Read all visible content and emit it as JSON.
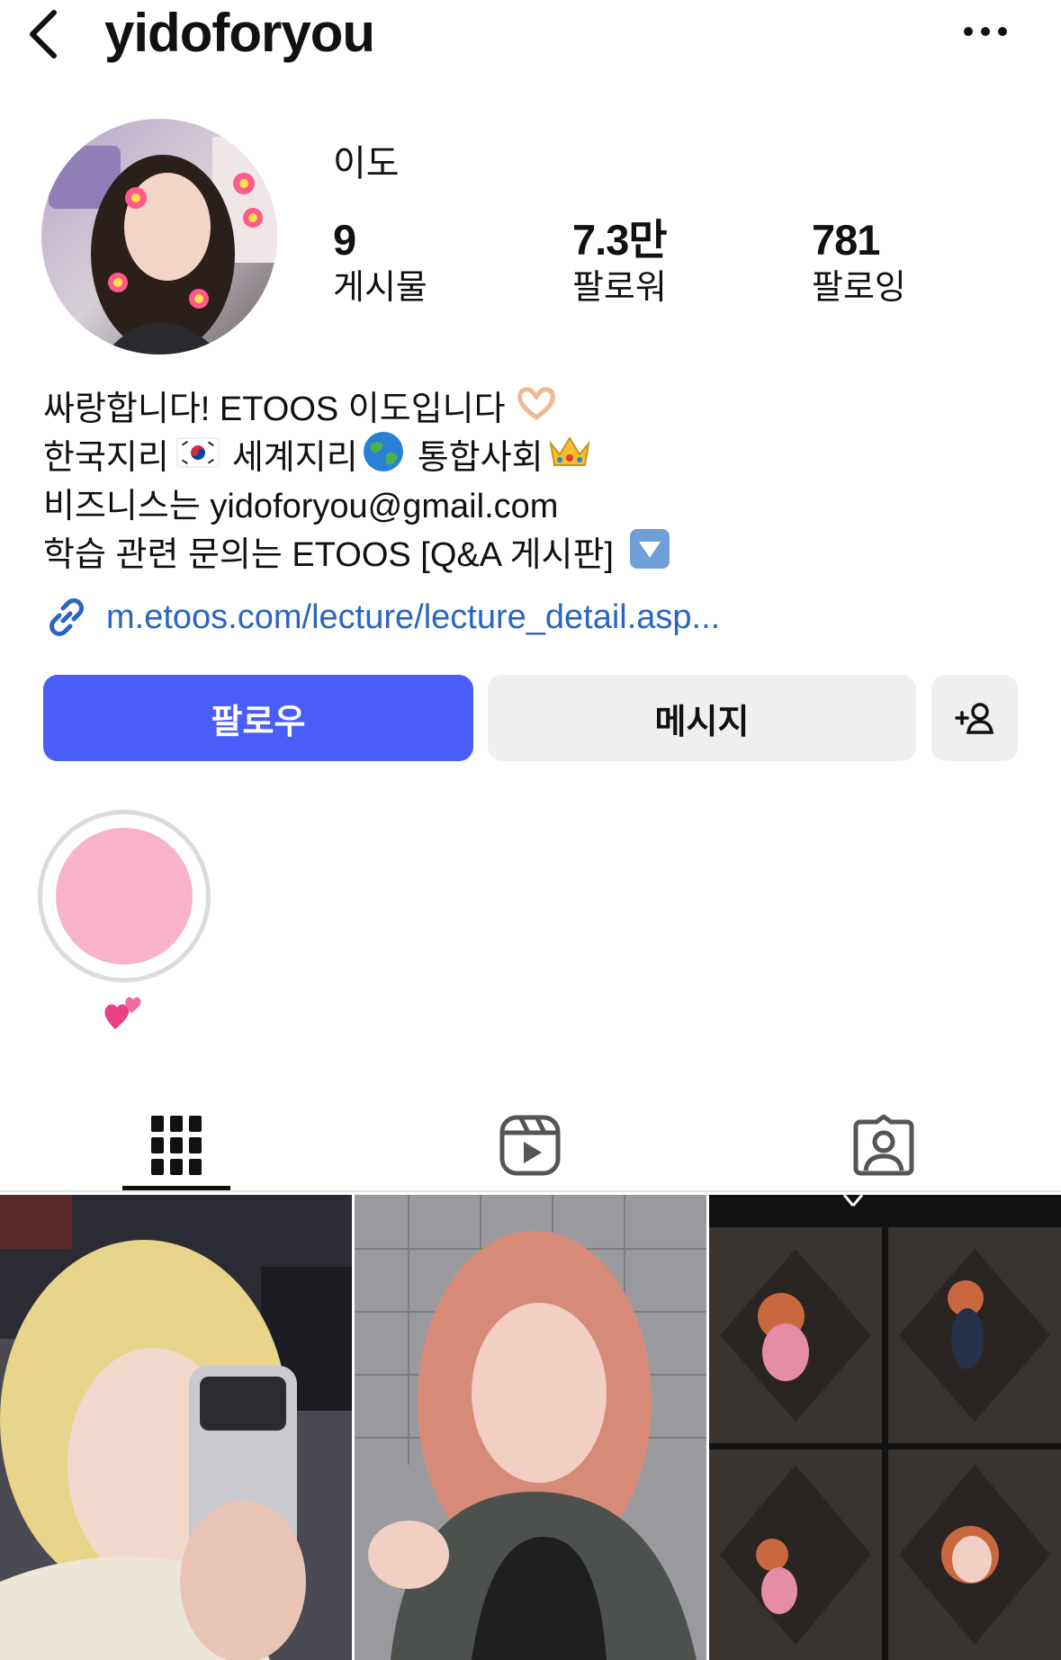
{
  "header": {
    "back_icon": "chevron-left-icon",
    "username": "yidoforyou",
    "more_icon": "more-horizontal-icon"
  },
  "profile": {
    "display_name": "이도",
    "stats": [
      {
        "value": "9",
        "label": "게시물"
      },
      {
        "value": "7.3만",
        "label": "팔로워"
      },
      {
        "value": "781",
        "label": "팔로잉"
      }
    ]
  },
  "bio": {
    "lines": [
      "싸랑합니다! ETOOS 이도입니다",
      "한국지리",
      "세계지리",
      "통합사회",
      "비즈니스는 yidoforyou@gmail.com",
      "학습 관련 문의는 ETOOS [Q&A 게시판]"
    ],
    "link": "m.etoos.com/lecture/lecture_detail.asp..."
  },
  "actions": {
    "follow": "팔로우",
    "message": "메시지",
    "add_user_icon": "add-person-icon"
  },
  "highlights": [
    {
      "label_icon": "two-hearts-icon",
      "color": "#f8b3c8"
    }
  ],
  "tabs": [
    {
      "icon": "grid-icon",
      "active": true
    },
    {
      "icon": "reels-icon",
      "active": false
    },
    {
      "icon": "tagged-person-icon",
      "active": false
    }
  ],
  "colors": {
    "accent": "#4a5df9",
    "link": "#2865c4",
    "button_secondary": "#efeff1"
  }
}
